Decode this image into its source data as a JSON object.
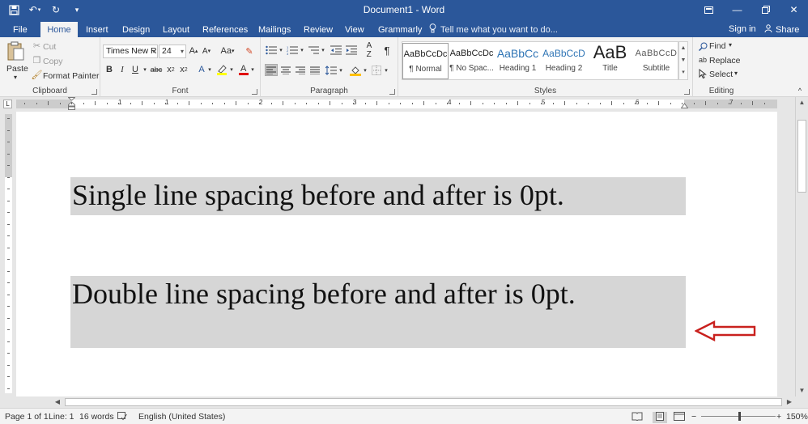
{
  "window": {
    "title": "Document1 - Word"
  },
  "tabs": {
    "file": "File",
    "home": "Home",
    "insert": "Insert",
    "design": "Design",
    "layout": "Layout",
    "references": "References",
    "mailings": "Mailings",
    "review": "Review",
    "view": "View",
    "grammarly": "Grammarly",
    "tell_me": "Tell me what you want to do...",
    "sign_in": "Sign in",
    "share": "Share"
  },
  "clipboard": {
    "paste": "Paste",
    "cut": "Cut",
    "copy": "Copy",
    "format_painter": "Format Painter",
    "label": "Clipboard"
  },
  "font": {
    "name": "Times New R",
    "size": "24",
    "label": "Font"
  },
  "paragraph": {
    "label": "Paragraph"
  },
  "styles": {
    "label": "Styles",
    "items": [
      {
        "sample": "AaBbCcDc",
        "name": "¶ Normal"
      },
      {
        "sample": "AaBbCcDc",
        "name": "¶ No Spac..."
      },
      {
        "sample": "AaBbCc",
        "name": "Heading 1"
      },
      {
        "sample": "AaBbCcD",
        "name": "Heading 2"
      },
      {
        "sample": "AaB",
        "name": "Title"
      },
      {
        "sample": "AaBbCcD",
        "name": "Subtitle"
      }
    ]
  },
  "editing": {
    "find": "Find",
    "replace": "Replace",
    "select": "Select",
    "label": "Editing"
  },
  "ruler": {
    "numbers": [
      "1",
      "1",
      "2",
      "3",
      "4",
      "5",
      "6",
      "7"
    ]
  },
  "document": {
    "paragraph1": "Single line spacing before and after is 0pt.",
    "paragraph2": "Double line spacing before and after is 0pt.",
    "paragraph1_line_spacing": "single",
    "paragraph2_line_spacing": "double",
    "highlight_color": "#d6d6d6",
    "annotation_arrow_color": "#c9211e"
  },
  "status": {
    "page": "Page 1 of 1",
    "line": "Line: 1",
    "words": "16 words",
    "language": "English (United States)",
    "zoom": "150%"
  },
  "theme": {
    "accent": "#2b579a"
  }
}
